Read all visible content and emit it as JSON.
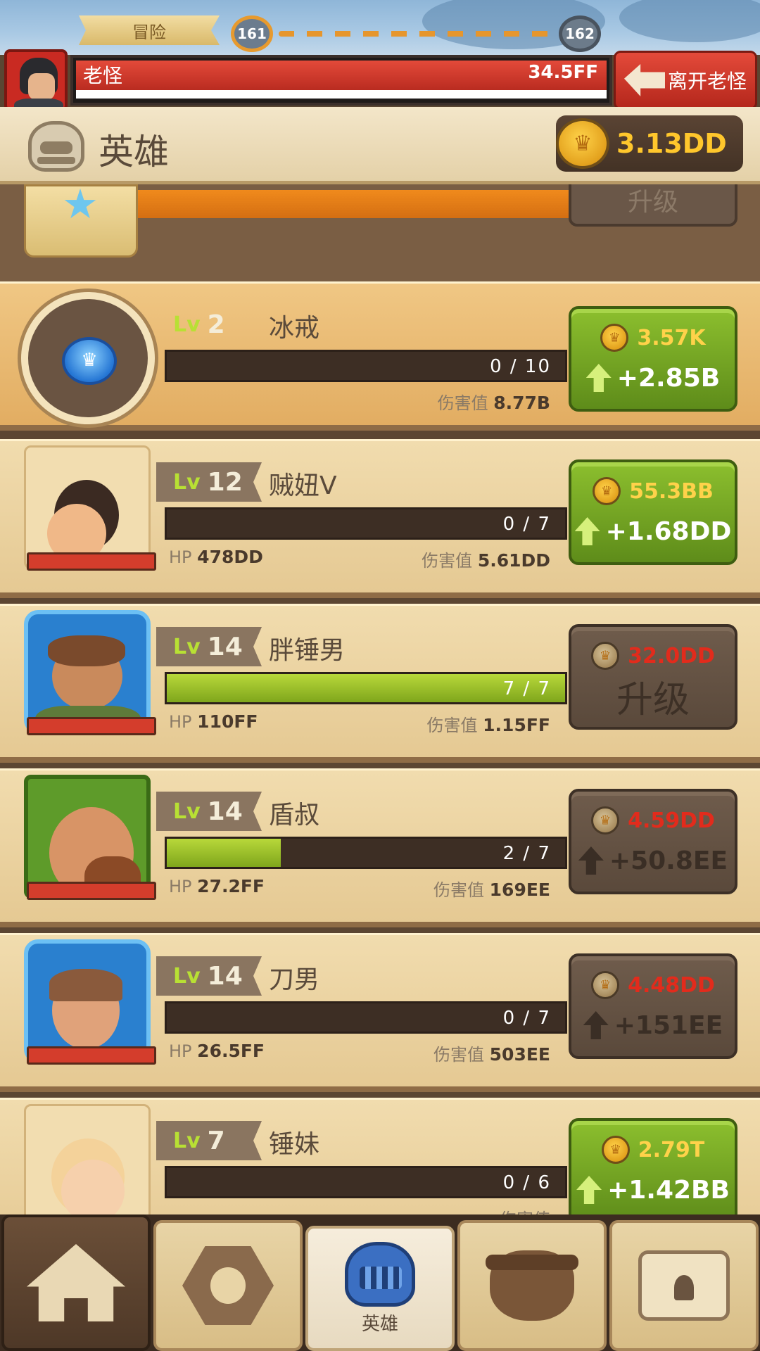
{
  "stage": {
    "tab_label": "冒险",
    "current": "161",
    "next": "162"
  },
  "boss": {
    "name": "老怪",
    "hp": "34.5FF",
    "leave_label": "离开老怪"
  },
  "section": {
    "title": "英雄",
    "gold": "3.13DD"
  },
  "colors": {
    "accent_green": "#7fa61c",
    "gold": "#ffc72c",
    "cost_unaffordable": "#e22b1c",
    "hp_red": "#d43d2c"
  },
  "heroes": [
    {
      "lv_prefix": "Lv",
      "level": "2",
      "name": "冰戒",
      "progress_text": "0 / 10",
      "progress": 0.0,
      "damage_label": "伤害值",
      "damage": "8.77B",
      "cost": "3.57K",
      "gain": "+2.85B",
      "affordable": true
    },
    {
      "lv_prefix": "Lv",
      "level": "12",
      "name": "贼妞V",
      "progress_text": "0 / 7",
      "progress": 0.0,
      "hp_label": "HP",
      "hp": "478DD",
      "damage_label": "伤害值",
      "damage": "5.61DD",
      "cost": "55.3BB",
      "gain": "+1.68DD",
      "affordable": true
    },
    {
      "lv_prefix": "Lv",
      "level": "14",
      "name": "胖锤男",
      "progress_text": "7 / 7",
      "progress": 1.0,
      "hp_label": "HP",
      "hp": "110FF",
      "damage_label": "伤害值",
      "damage": "1.15FF",
      "cost": "32.0DD",
      "button_label": "升级",
      "affordable": false
    },
    {
      "lv_prefix": "Lv",
      "level": "14",
      "name": "盾叔",
      "progress_text": "2 / 7",
      "progress": 0.286,
      "hp_label": "HP",
      "hp": "27.2FF",
      "damage_label": "伤害值",
      "damage": "169EE",
      "cost": "4.59DD",
      "gain": "+50.8EE",
      "affordable": false
    },
    {
      "lv_prefix": "Lv",
      "level": "14",
      "name": "刀男",
      "progress_text": "0 / 7",
      "progress": 0.0,
      "hp_label": "HP",
      "hp": "26.5FF",
      "damage_label": "伤害值",
      "damage": "503EE",
      "cost": "4.48DD",
      "gain": "+151EE",
      "affordable": false
    },
    {
      "lv_prefix": "Lv",
      "level": "7",
      "name": "锤妹",
      "progress_text": "0 / 6",
      "progress": 0.0,
      "damage_label": "伤害值",
      "cost": "2.79T",
      "gain": "+1.42BB",
      "affordable": true
    }
  ],
  "peek_row": {
    "button_label": "升级"
  },
  "nav": {
    "tabs": [
      {
        "icon": "house-icon"
      },
      {
        "icon": "hexagon-icon"
      },
      {
        "icon": "helmet-icon",
        "label": "英雄",
        "active": true
      },
      {
        "icon": "cauldron-icon"
      },
      {
        "icon": "chest-icon"
      }
    ]
  }
}
